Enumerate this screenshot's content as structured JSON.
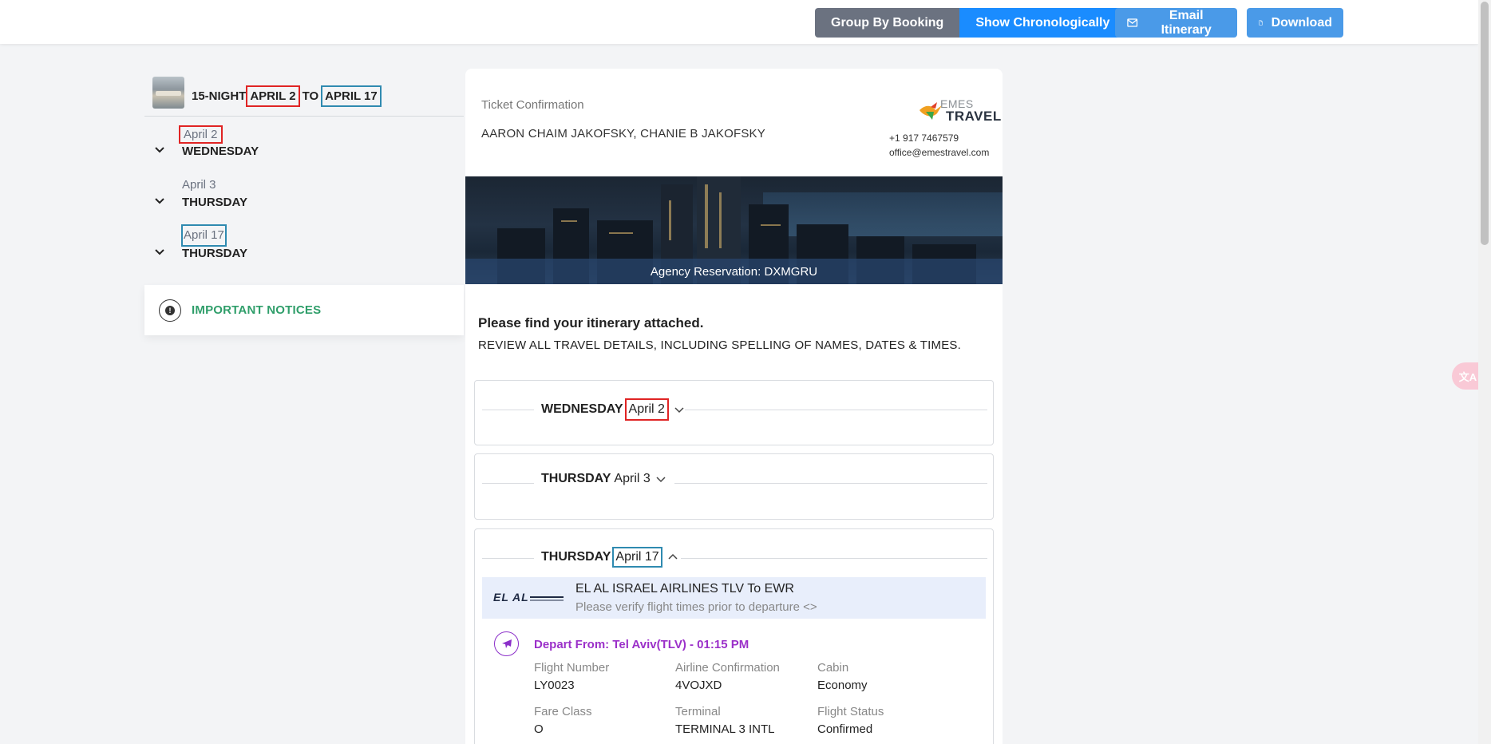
{
  "toolbar": {
    "group_by_booking": "Group By Booking",
    "show_chronologically": "Show Chronologically",
    "email_itinerary": "Email Itinerary",
    "download": "Download"
  },
  "sidebar": {
    "trip_prefix": "15-NIGHT",
    "trip_start": "APRIL 2",
    "trip_to": "TO",
    "trip_end": "APRIL 17",
    "days": [
      {
        "date": "April 2",
        "weekday": "WEDNESDAY"
      },
      {
        "date": "April 3",
        "weekday": "THURSDAY"
      },
      {
        "date": "April 17",
        "weekday": "THURSDAY"
      }
    ],
    "notices_label": "IMPORTANT NOTICES"
  },
  "header": {
    "ticket_label": "Ticket Confirmation",
    "passengers": "AARON CHAIM JAKOFSKY, CHANIE B JAKOFSKY",
    "logo_top": "EMES",
    "logo_bottom": "TRAVEL",
    "phone": "+1 917 7467579",
    "email": "office@emestravel.com"
  },
  "banner": {
    "caption": "Agency Reservation: DXMGRU"
  },
  "message": {
    "title": "Please find your itinerary attached.",
    "subtitle": "REVIEW ALL TRAVEL DETAILS, INCLUDING SPELLING OF NAMES, DATES & TIMES."
  },
  "sections": [
    {
      "weekday": "WEDNESDAY",
      "date": "April 2"
    },
    {
      "weekday": "THURSDAY",
      "date": "April 3"
    },
    {
      "weekday": "THURSDAY",
      "date": "April 17"
    }
  ],
  "flight": {
    "airline_logo_text": "EL AL",
    "title": "EL AL ISRAEL AIRLINES TLV To EWR",
    "note": "Please verify flight times prior to departure <>",
    "depart": "Depart From: Tel Aviv(TLV) - 01:15 PM",
    "fields": {
      "flight_number_label": "Flight Number",
      "flight_number": "LY0023",
      "airline_conf_label": "Airline Confirmation",
      "airline_conf": "4VOJXD",
      "cabin_label": "Cabin",
      "cabin": "Economy",
      "fare_class_label": "Fare Class",
      "fare_class": "O",
      "terminal_label": "Terminal",
      "terminal": "TERMINAL 3 INTL",
      "status_label": "Flight Status",
      "status": "Confirmed"
    }
  },
  "colors": {
    "primary_blue": "#1a8cff",
    "button_blue": "#4a9ae8",
    "notice_green": "#2f9e6a",
    "depart_purple": "#9b30c9",
    "annotation_red": "#e02424",
    "annotation_blue": "#2f8ab0"
  }
}
